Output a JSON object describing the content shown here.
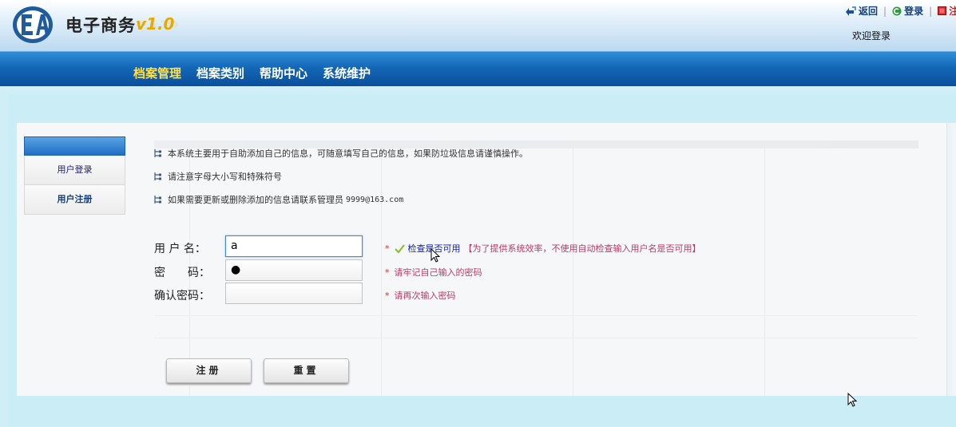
{
  "header": {
    "app_title": "电子商务",
    "version": "v1.0",
    "links": [
      {
        "label": "返回",
        "icon": "back-arrow-icon"
      },
      {
        "label": "登录",
        "icon": "login-icon"
      },
      {
        "label": "注",
        "icon": "logout-icon"
      }
    ],
    "welcome": "欢迎登录"
  },
  "nav": {
    "items": [
      "档案管理",
      "档案类别",
      "帮助中心",
      "系统维护"
    ],
    "active_index": 0
  },
  "sidebar": {
    "items": [
      {
        "label": "用户登录"
      },
      {
        "label": "用户注册"
      }
    ]
  },
  "notes": [
    {
      "text": "本系统主要用于自助添加自己的信息，可随意填写自己的信息，如果防垃圾信息请谨慎操作。"
    },
    {
      "text": "请注意字母大小写和特殊符号"
    },
    {
      "text": "如果需要更新或删除添加的信息请联系管理员",
      "email": "9999@163.com"
    }
  ],
  "form": {
    "username": {
      "label": "用 户 名：",
      "value": "a",
      "star": "*",
      "check_link": "检查是否可用",
      "hint": "【为了提供系统效率，不使用自动检查输入用户名是否可用】"
    },
    "password": {
      "label": "密　　码：",
      "value": "●",
      "star": "*",
      "hint": "请牢记自己输入的密码"
    },
    "confirm": {
      "label": "确认密码：",
      "value": "",
      "star": "*",
      "hint": "请再次输入密码"
    }
  },
  "buttons": {
    "register": "注册",
    "reset": "重置"
  },
  "colors": {
    "nav_active": "#ffe14d",
    "nav_bg": "#1467b7",
    "hint": "#b83a64",
    "link": "#0d1fa8",
    "accent_version": "#e8a800"
  }
}
